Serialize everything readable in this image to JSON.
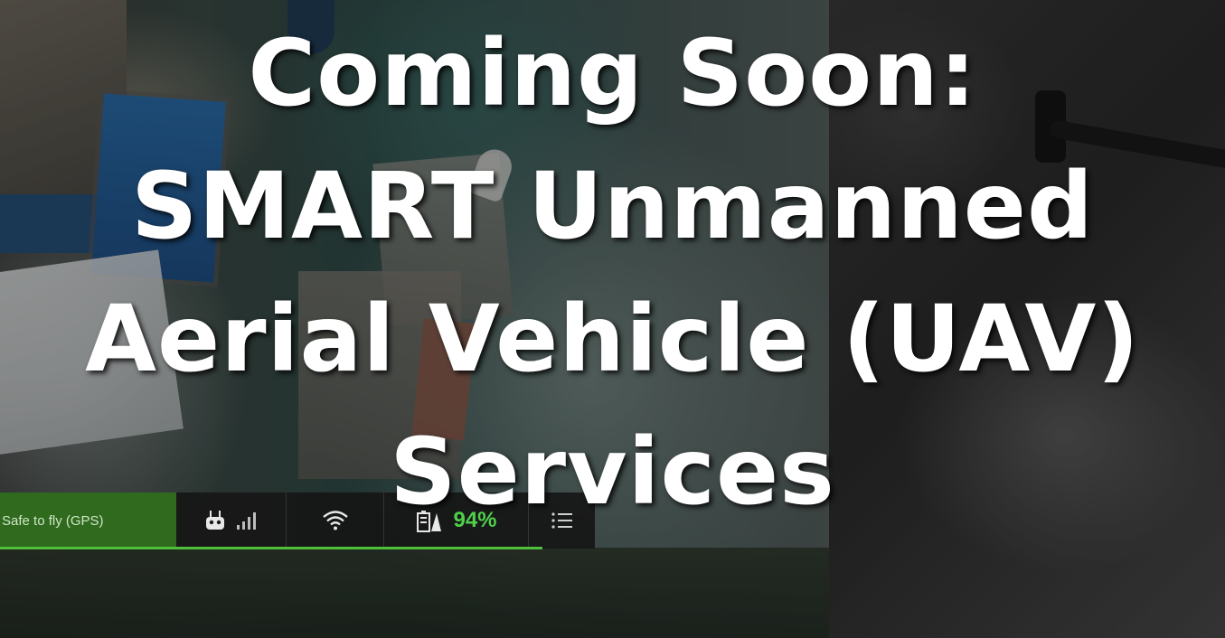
{
  "headline": {
    "lines": [
      "Coming Soon:",
      "SMART Unmanned",
      "Aerial Vehicle (UAV)",
      "Services"
    ]
  },
  "hud": {
    "status": "Safe to fly (GPS)",
    "battery_percent": "94%",
    "accent_color": "#4fd04a",
    "status_bg_color": "#2f6a1e",
    "icons": [
      "remote-controller-icon",
      "signal-bars-icon",
      "wifi-icon",
      "battery-icon",
      "menu-icon"
    ]
  }
}
